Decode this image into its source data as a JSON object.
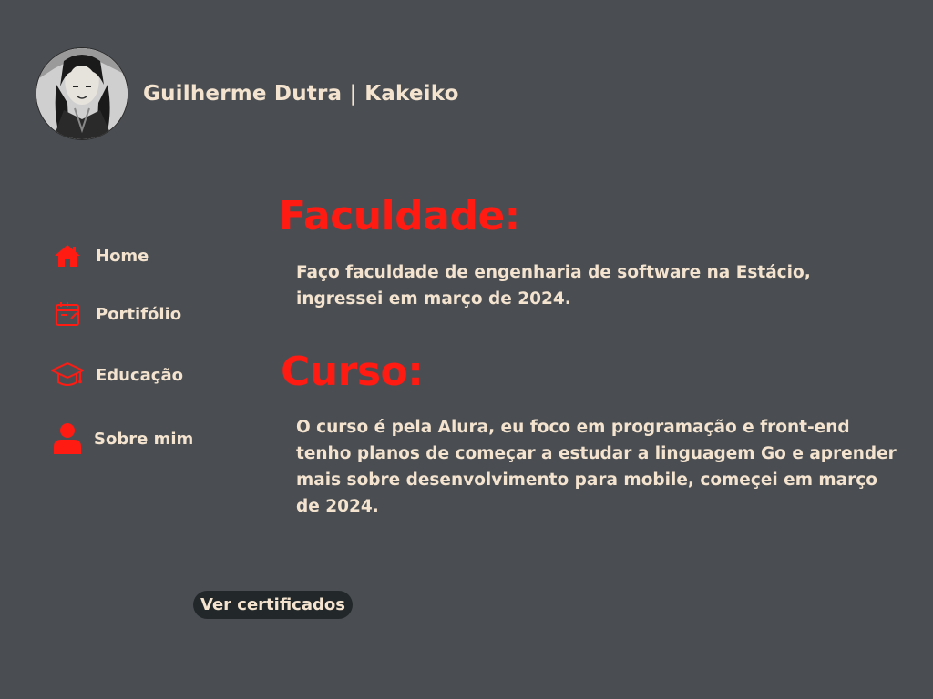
{
  "header": {
    "site_title": "Guilherme Dutra | Kakeiko",
    "avatar_icon": "profile-photo"
  },
  "nav": {
    "items": [
      {
        "label": "Home",
        "icon": "home-icon"
      },
      {
        "label": "Portifólio",
        "icon": "portfolio-icon"
      },
      {
        "label": "Educação",
        "icon": "graduation-cap-icon"
      },
      {
        "label": "Sobre mim",
        "icon": "user-icon"
      }
    ]
  },
  "sections": [
    {
      "title": "Faculdade:",
      "text": "Faço faculdade de engenharia de software na Estácio, ingressei em março de 2024."
    },
    {
      "title": "Curso:",
      "text": "O curso é pela Alura, eu foco em programação e front-end tenho planos de começar a estudar a linguagem Go e aprender mais sobre desenvolvimento para mobile, começei em março de 2024."
    }
  ],
  "cert_button": {
    "label": "Ver certificados"
  },
  "colors": {
    "background": "#4a4e52",
    "accent": "#ff1a12",
    "text": "#f3e3cf",
    "button_bg": "#22282a"
  }
}
